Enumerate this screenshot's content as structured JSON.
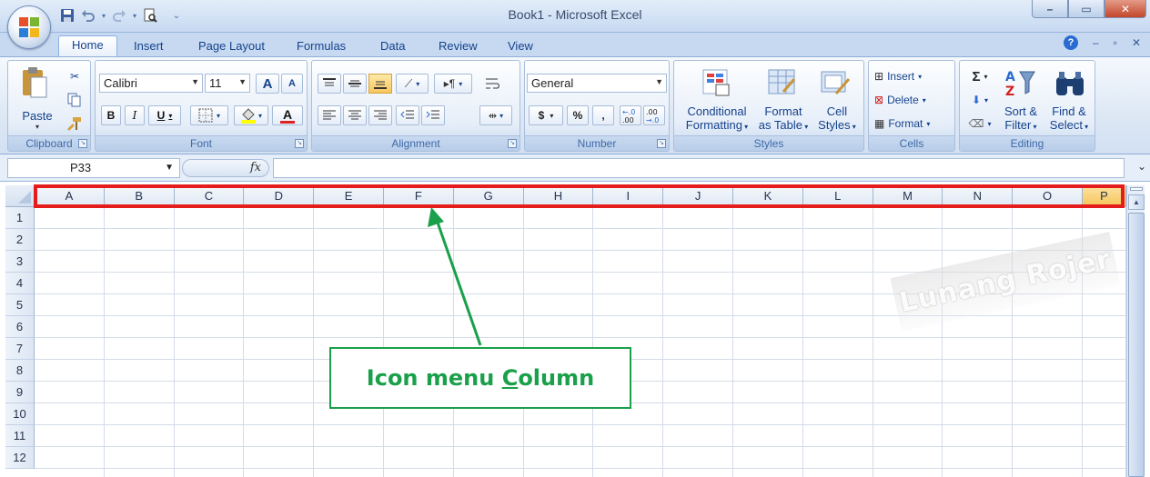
{
  "window": {
    "title": "Book1 - Microsoft Excel",
    "min_label": "–",
    "max_label": "▭",
    "close_label": "✕"
  },
  "quick_access": [
    "save-icon",
    "undo-icon",
    "redo-icon",
    "print-preview-icon",
    "customize-icon"
  ],
  "tabs": [
    {
      "label": "Home",
      "active": true
    },
    {
      "label": "Insert"
    },
    {
      "label": "Page Layout"
    },
    {
      "label": "Formulas"
    },
    {
      "label": "Data"
    },
    {
      "label": "Review"
    },
    {
      "label": "View"
    }
  ],
  "tab_controls": {
    "help": "?",
    "min": "–",
    "restore": "▫",
    "close": "✕"
  },
  "ribbon": {
    "clipboard": {
      "label": "Clipboard",
      "paste": "Paste"
    },
    "font": {
      "label": "Font",
      "name": "Calibri",
      "size": "11",
      "grow": "A",
      "shrink": "A",
      "bold": "B",
      "italic": "I",
      "underline": "U",
      "font_color": "A"
    },
    "alignment": {
      "label": "Alignment"
    },
    "number": {
      "label": "Number",
      "format": "General",
      "currency": "$",
      "percent": "%",
      "comma": ",",
      "inc_dec": "+.0 .00",
      "dec_dec": ".00 →.0"
    },
    "styles": {
      "label": "Styles",
      "conditional": "Conditional",
      "conditional2": "Formatting",
      "format_table": "Format",
      "format_table2": "as Table",
      "cell_styles": "Cell",
      "cell_styles2": "Styles"
    },
    "cells": {
      "label": "Cells",
      "insert": "Insert",
      "delete": "Delete",
      "format": "Format"
    },
    "editing": {
      "label": "Editing",
      "sigma": "Σ",
      "sort": "Sort &",
      "sort2": "Filter",
      "find": "Find &",
      "find2": "Select"
    }
  },
  "formula_bar": {
    "name_box": "P33",
    "fx": "fx",
    "value": ""
  },
  "grid": {
    "columns": [
      "A",
      "B",
      "C",
      "D",
      "E",
      "F",
      "G",
      "H",
      "I",
      "J",
      "K",
      "L",
      "M",
      "N",
      "O",
      "P"
    ],
    "selected_column": "P",
    "rows": [
      "1",
      "2",
      "3",
      "4",
      "5",
      "6",
      "7",
      "8",
      "9",
      "10",
      "11",
      "12"
    ]
  },
  "watermark": "Lunang Rojer",
  "annotation": {
    "text_before": "Icon menu ",
    "underlined": "C",
    "text_after": "olumn"
  },
  "colors": {
    "highlight": "#e41c1c",
    "annotation": "#1aa04a",
    "selected_header": "#f6c55b"
  }
}
